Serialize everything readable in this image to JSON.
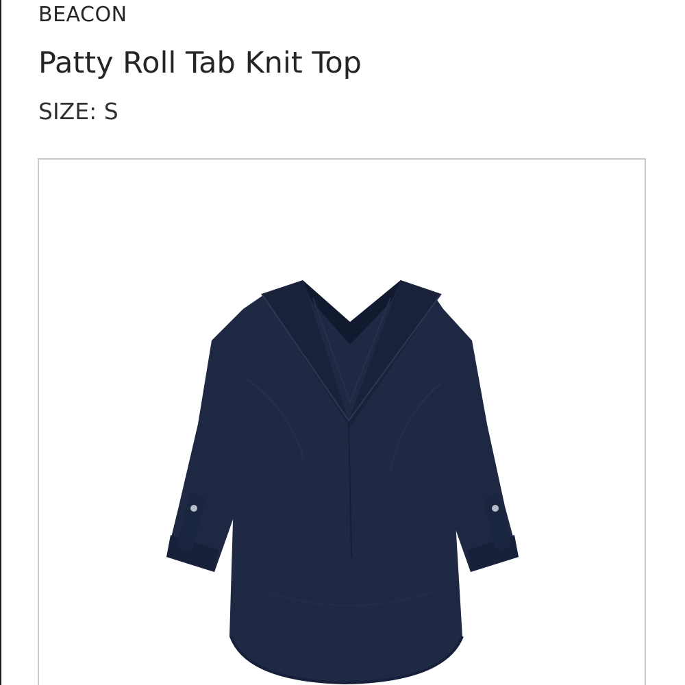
{
  "product": {
    "brand": "BEACON",
    "name": "Patty Roll Tab Knit Top",
    "size_label": "SIZE: S"
  },
  "image": {
    "subject": "navy-v-neck-roll-tab-knit-top",
    "garment_color": "#1e2842",
    "frame_border_color": "#c9c9c9"
  }
}
